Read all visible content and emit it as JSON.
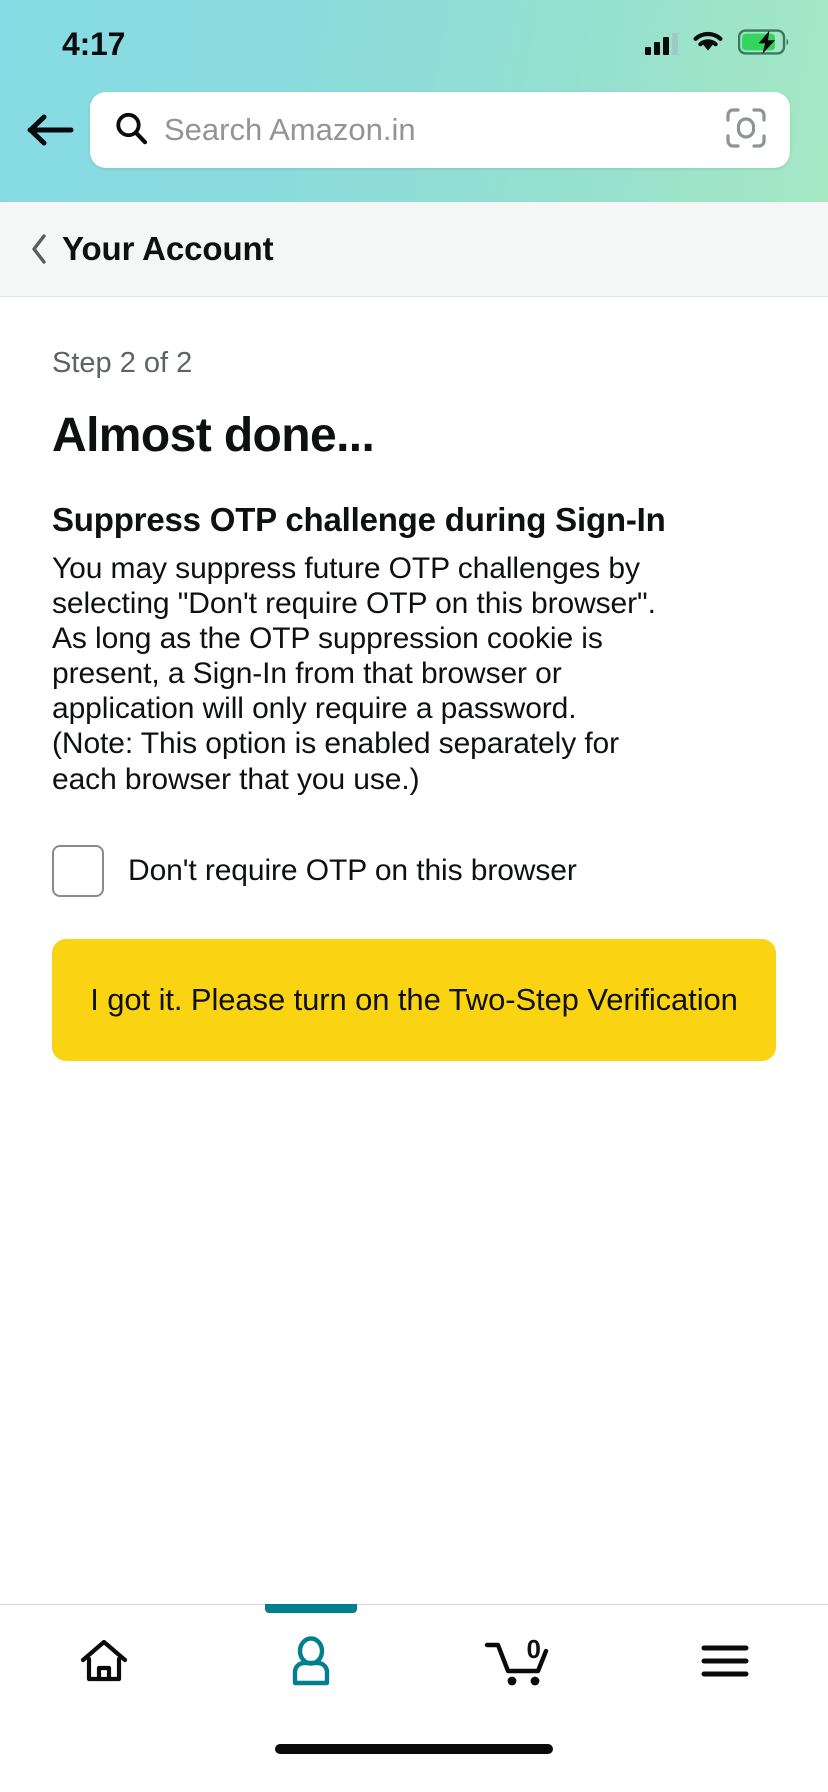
{
  "status_bar": {
    "time": "4:17",
    "signal_icon": "cellular-signal-icon",
    "wifi_icon": "wifi-icon",
    "battery_icon": "battery-charging-icon"
  },
  "header": {
    "back_icon": "back-arrow-icon",
    "search": {
      "placeholder": "Search Amazon.in",
      "search_icon": "search-icon",
      "camera_icon": "camera-scan-icon"
    }
  },
  "subheader": {
    "back_chevron": "chevron-left-icon",
    "title": "Your Account"
  },
  "main": {
    "step_label": "Step 2 of 2",
    "page_title": "Almost done...",
    "section_title": "Suppress OTP challenge during Sign-In",
    "section_body": "You may suppress future OTP challenges by selecting \"Don't require OTP on this browser\". As long as the OTP suppression cookie is present, a Sign-In from that browser or application will only require a password. (Note: This option is enabled separately for each browser that you use.)",
    "checkbox": {
      "label": "Don't require OTP on this browser",
      "checked": false
    },
    "cta_label": "I got it. Please turn on the Two-Step Verification"
  },
  "bottom_nav": {
    "items": [
      {
        "name": "home",
        "icon": "home-icon",
        "active": false
      },
      {
        "name": "account",
        "icon": "person-icon",
        "active": true
      },
      {
        "name": "cart",
        "icon": "shopping-cart-icon",
        "badge": "0",
        "active": false
      },
      {
        "name": "menu",
        "icon": "hamburger-menu-icon",
        "active": false
      }
    ]
  },
  "colors": {
    "header_gradient_start": "#86dbe4",
    "header_gradient_end": "#a6e8c4",
    "accent_teal": "#007f8c",
    "cta_yellow": "#fad312",
    "subheader_bg": "#f5f6f6",
    "text_primary": "#0f1111",
    "text_muted": "#5f6365"
  }
}
